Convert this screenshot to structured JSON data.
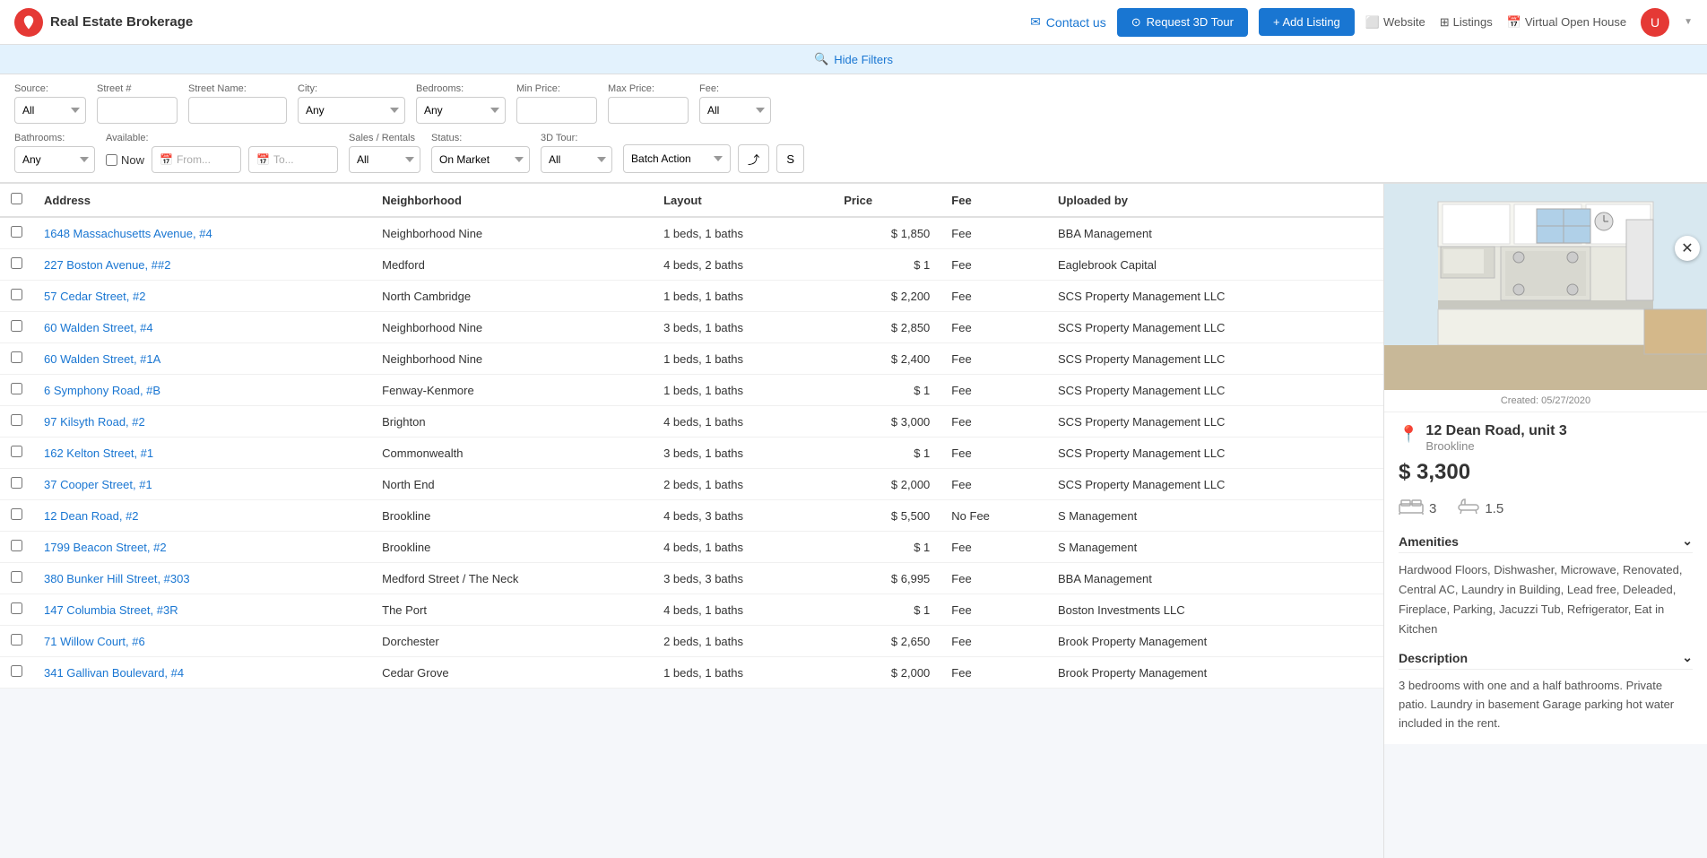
{
  "navbar": {
    "brand_name": "Real Estate Brokerage",
    "contact_label": "Contact us",
    "btn_3d_label": "Request 3D Tour",
    "btn_add_label": "+ Add Listing",
    "website_label": "Website",
    "listings_label": "Listings",
    "virtual_open_house_label": "Virtual Open House"
  },
  "filter_bar": {
    "toggle_label": "Hide Filters",
    "source_label": "Source:",
    "source_default": "All",
    "street_num_label": "Street #",
    "street_name_label": "Street Name:",
    "city_label": "City:",
    "city_default": "Any",
    "bedrooms_label": "Bedrooms:",
    "bedrooms_default": "Any",
    "min_price_label": "Min Price:",
    "max_price_label": "Max Price:",
    "fee_label": "Fee:",
    "fee_default": "All",
    "bathrooms_label": "Bathrooms:",
    "bathrooms_default": "Any",
    "available_label": "Available:",
    "now_label": "Now",
    "from_label": "From...",
    "to_label": "To...",
    "sales_rentals_label": "Sales / Rentals",
    "sales_default": "All",
    "status_label": "Status:",
    "status_default": "On Market",
    "tour_3d_label": "3D Tour:",
    "tour_default": "All",
    "batch_action_label": "Batch Action"
  },
  "table": {
    "headers": [
      "",
      "Address",
      "Neighborhood",
      "Layout",
      "Price",
      "Fee",
      "Uploaded by"
    ],
    "rows": [
      {
        "address": "1648 Massachusetts Avenue, #4",
        "neighborhood": "Neighborhood Nine",
        "layout": "1 beds, 1 baths",
        "price": "$ 1,850",
        "fee": "Fee",
        "uploaded_by": "BBA Management"
      },
      {
        "address": "227 Boston Avenue, ##2",
        "neighborhood": "Medford",
        "layout": "4 beds, 2 baths",
        "price": "$ 1",
        "fee": "Fee",
        "uploaded_by": "Eaglebrook Capital"
      },
      {
        "address": "57 Cedar Street, #2",
        "neighborhood": "North Cambridge",
        "layout": "1 beds, 1 baths",
        "price": "$ 2,200",
        "fee": "Fee",
        "uploaded_by": "SCS Property Management LLC"
      },
      {
        "address": "60 Walden Street, #4",
        "neighborhood": "Neighborhood Nine",
        "layout": "3 beds, 1 baths",
        "price": "$ 2,850",
        "fee": "Fee",
        "uploaded_by": "SCS Property Management LLC"
      },
      {
        "address": "60 Walden Street, #1A",
        "neighborhood": "Neighborhood Nine",
        "layout": "1 beds, 1 baths",
        "price": "$ 2,400",
        "fee": "Fee",
        "uploaded_by": "SCS Property Management LLC"
      },
      {
        "address": "6 Symphony Road, #B",
        "neighborhood": "Fenway-Kenmore",
        "layout": "1 beds, 1 baths",
        "price": "$ 1",
        "fee": "Fee",
        "uploaded_by": "SCS Property Management LLC"
      },
      {
        "address": "97 Kilsyth Road, #2",
        "neighborhood": "Brighton",
        "layout": "4 beds, 1 baths",
        "price": "$ 3,000",
        "fee": "Fee",
        "uploaded_by": "SCS Property Management LLC"
      },
      {
        "address": "162 Kelton Street, #1",
        "neighborhood": "Commonwealth",
        "layout": "3 beds, 1 baths",
        "price": "$ 1",
        "fee": "Fee",
        "uploaded_by": "SCS Property Management LLC"
      },
      {
        "address": "37 Cooper Street, #1",
        "neighborhood": "North End",
        "layout": "2 beds, 1 baths",
        "price": "$ 2,000",
        "fee": "Fee",
        "uploaded_by": "SCS Property Management LLC"
      },
      {
        "address": "12 Dean Road, #2",
        "neighborhood": "Brookline",
        "layout": "4 beds, 3 baths",
        "price": "$ 5,500",
        "fee": "No Fee",
        "uploaded_by": "S Management"
      },
      {
        "address": "1799 Beacon Street, #2",
        "neighborhood": "Brookline",
        "layout": "4 beds, 1 baths",
        "price": "$ 1",
        "fee": "Fee",
        "uploaded_by": "S Management"
      },
      {
        "address": "380 Bunker Hill Street, #303",
        "neighborhood": "Medford Street / The Neck",
        "layout": "3 beds, 3 baths",
        "price": "$ 6,995",
        "fee": "Fee",
        "uploaded_by": "BBA Management"
      },
      {
        "address": "147 Columbia Street, #3R",
        "neighborhood": "The Port",
        "layout": "4 beds, 1 baths",
        "price": "$ 1",
        "fee": "Fee",
        "uploaded_by": "Boston Investments LLC"
      },
      {
        "address": "71 Willow Court, #6",
        "neighborhood": "Dorchester",
        "layout": "2 beds, 1 baths",
        "price": "$ 2,650",
        "fee": "Fee",
        "uploaded_by": "Brook Property Management"
      },
      {
        "address": "341 Gallivan Boulevard, #4",
        "neighborhood": "Cedar Grove",
        "layout": "1 beds, 1 baths",
        "price": "$ 2,000",
        "fee": "Fee",
        "uploaded_by": "Brook Property Management"
      }
    ]
  },
  "detail": {
    "created_date": "Created: 05/27/2020",
    "address_line1": "12 Dean Road, unit 3",
    "address_line2": "Brookline",
    "price": "$ 3,300",
    "beds": "3",
    "baths": "1.5",
    "amenities_title": "Amenities",
    "amenities": "Hardwood Floors,   Dishwasher,   Microwave,   Renovated,   Central AC,   Laundry in Building,   Lead free,   Deleaded,   Fireplace,   Parking,   Jacuzzi Tub,   Refrigerator,   Eat in Kitchen",
    "description_title": "Description",
    "description": "3 bedrooms with one and a half bathrooms. Private patio. Laundry in basement Garage parking hot water included in the rent."
  }
}
